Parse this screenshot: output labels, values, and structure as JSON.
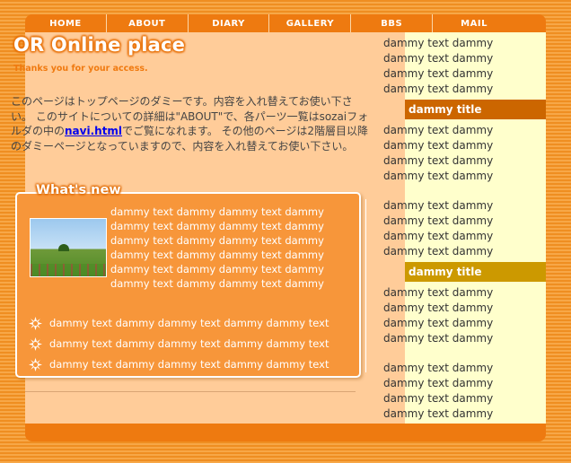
{
  "nav": {
    "items": [
      {
        "label": "HOME"
      },
      {
        "label": "ABOUT"
      },
      {
        "label": "DIARY"
      },
      {
        "label": "GALLERY"
      },
      {
        "label": "BBS"
      },
      {
        "label": "MAIL"
      }
    ]
  },
  "header": {
    "title": "OR Online place",
    "subtitle": "Thanks you for your access."
  },
  "intro": {
    "text_before_link": "このページはトップページのダミーです。内容を入れ替えてお使い下さい。 このサイトについての詳細は\"ABOUT\"で、各パーツ一覧はsozaiフォルダの中の",
    "link_label": "navi.html",
    "text_after_link": "でご覧になれます。 その他のページは2階層目以降のダミーページとなっていますので、内容を入れ替えてお使い下さい。"
  },
  "whats_new": {
    "title": "What's new",
    "photo_icon": "landscape-photo",
    "body": "dammy text dammy dammy text dammy dammy text dammy dammy text dammy dammy text dammy dammy text dammy dammy text dammy dammy text dammy dammy text dammy dammy text dammy dammy text dammy dammy text dammy",
    "items": [
      "dammy text dammy dammy text dammy dammy text",
      "dammy text dammy dammy text dammy dammy text",
      "dammy text dammy dammy text dammy dammy text"
    ],
    "bullet_icon": "starburst-icon"
  },
  "sidebar": {
    "block1": [
      "dammy text dammy",
      "dammy text dammy",
      "dammy text dammy",
      "dammy text dammy"
    ],
    "title1": "dammy title",
    "block2": [
      "dammy text dammy",
      "dammy text dammy",
      "dammy text dammy",
      "dammy text dammy"
    ],
    "block3": [
      "dammy text dammy",
      "dammy text dammy",
      "dammy text dammy",
      "dammy text dammy"
    ],
    "title2": "dammy title",
    "block4": [
      "dammy text dammy",
      "dammy text dammy",
      "dammy text dammy",
      "dammy text dammy"
    ],
    "block5": [
      "dammy text dammy",
      "dammy text dammy",
      "dammy text dammy",
      "dammy text dammy"
    ]
  },
  "colors": {
    "nav_bar": "#ee7a10",
    "main_bg": "#ffcc99",
    "sidebar_bg": "#ffffcc",
    "sidebar_title1": "#cc6600",
    "sidebar_title2": "#cc9900",
    "news_box": "#f7963a"
  }
}
